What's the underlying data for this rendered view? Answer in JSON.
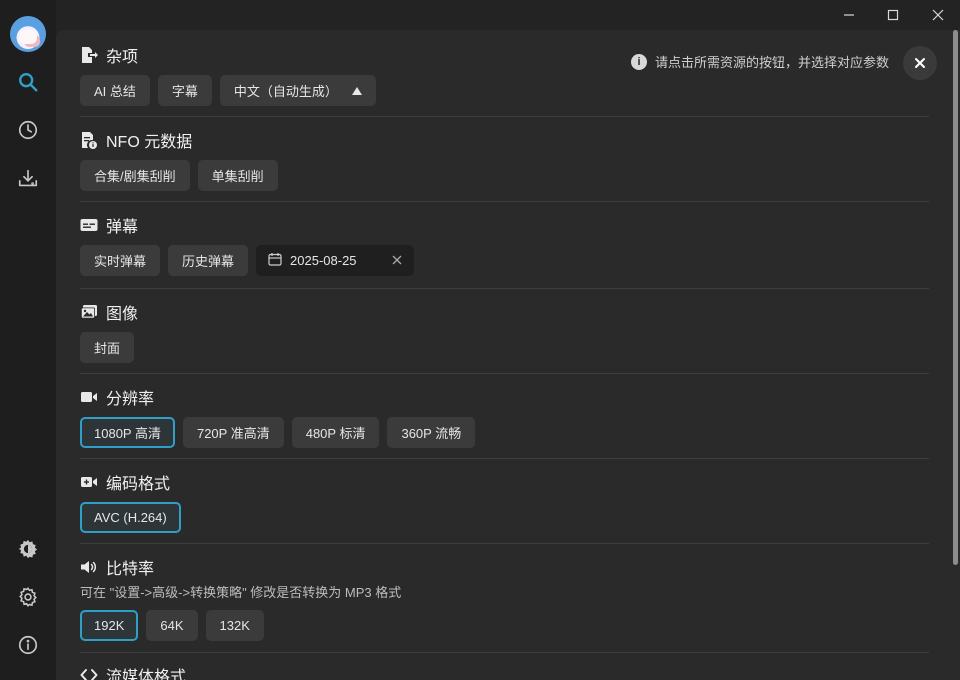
{
  "hint": {
    "info_glyph": "i",
    "text": "请点击所需资源的按钮，并选择对应参数"
  },
  "sections": {
    "misc": {
      "title": "杂项",
      "chips": [
        "AI 总结",
        "字幕"
      ],
      "dropdown_value": "中文（自动生成）"
    },
    "nfo": {
      "title": "NFO 元数据",
      "chips": [
        "合集/剧集刮削",
        "单集刮削"
      ]
    },
    "danmaku": {
      "title": "弹幕",
      "chips": [
        "实时弹幕",
        "历史弹幕"
      ],
      "date": "2025-08-25"
    },
    "image": {
      "title": "图像",
      "chips": [
        "封面"
      ]
    },
    "resolution": {
      "title": "分辨率",
      "chips": [
        "1080P 高清",
        "720P 准高清",
        "480P 标清",
        "360P 流畅"
      ],
      "selected": "1080P 高清"
    },
    "codec": {
      "title": "编码格式",
      "chips": [
        "AVC (H.264)"
      ],
      "selected": "AVC (H.264)"
    },
    "bitrate": {
      "title": "比特率",
      "note": "可在 \"设置->高级->转换策略\" 修改是否转换为 MP3 格式",
      "chips": [
        "192K",
        "64K",
        "132K"
      ],
      "selected": "192K"
    },
    "stream": {
      "title": "流媒体格式"
    }
  },
  "colors": {
    "accent": "#2f9fc8",
    "sidebar_bg": "#1e1e1e",
    "content_bg": "#2a2a2a",
    "chip_bg": "#3b3b3b"
  }
}
